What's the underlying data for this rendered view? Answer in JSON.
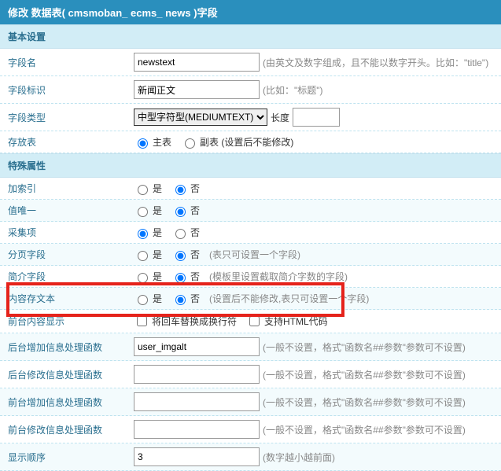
{
  "title": "修改 数据表( cmsmoban_ ecms_ news )字段",
  "section_basic": "基本设置",
  "section_special": "特殊属性",
  "fields": {
    "name": {
      "label": "字段名",
      "value": "newstext",
      "hint": "(由英文及数字组成，且不能以数字开头。比如：\"title\")"
    },
    "ident": {
      "label": "字段标识",
      "value": "新闻正文",
      "hint": "(比如：\"标题\")"
    },
    "type": {
      "label": "字段类型",
      "select": "中型字符型(MEDIUMTEXT)",
      "len_label": "长度",
      "len_value": ""
    },
    "store": {
      "label": "存放表",
      "radio_main": "主表",
      "radio_sub": "副表 (设置后不能修改)",
      "checked": "main"
    },
    "index": {
      "label": "加索引",
      "yes": "是",
      "no": "否",
      "checked": "no",
      "hint": ""
    },
    "unique": {
      "label": "值唯一",
      "yes": "是",
      "no": "否",
      "checked": "no",
      "hint": ""
    },
    "collect": {
      "label": "采集项",
      "yes": "是",
      "no": "否",
      "checked": "yes",
      "hint": ""
    },
    "page": {
      "label": "分页字段",
      "yes": "是",
      "no": "否",
      "checked": "no",
      "hint": "(表只可设置一个字段)"
    },
    "intro": {
      "label": "简介字段",
      "yes": "是",
      "no": "否",
      "checked": "no",
      "hint": "(模板里设置截取简介字数的字段)"
    },
    "content": {
      "label": "内容存文本",
      "yes": "是",
      "no": "否",
      "checked": "no",
      "hint": "(设置后不能修改,表只可设置一个字段)"
    },
    "front_display": {
      "label": "前台内容显示",
      "a": "将回车替换成换行符",
      "b": "支持HTML代码"
    },
    "back_add": {
      "label": "后台增加信息处理函数",
      "value": "user_imgalt",
      "hint": "(一般不设置，格式\"函数名##参数\"参数可不设置)"
    },
    "back_edit": {
      "label": "后台修改信息处理函数",
      "value": "",
      "hint": "(一般不设置，格式\"函数名##参数\"参数可不设置)"
    },
    "front_add": {
      "label": "前台增加信息处理函数",
      "value": "",
      "hint": "(一般不设置，格式\"函数名##参数\"参数可不设置)"
    },
    "front_edit": {
      "label": "前台修改信息处理函数",
      "value": "",
      "hint": "(一般不设置，格式\"函数名##参数\"参数可不设置)"
    },
    "order": {
      "label": "显示顺序",
      "value": "3",
      "hint": "(数字越小越前面)"
    }
  }
}
